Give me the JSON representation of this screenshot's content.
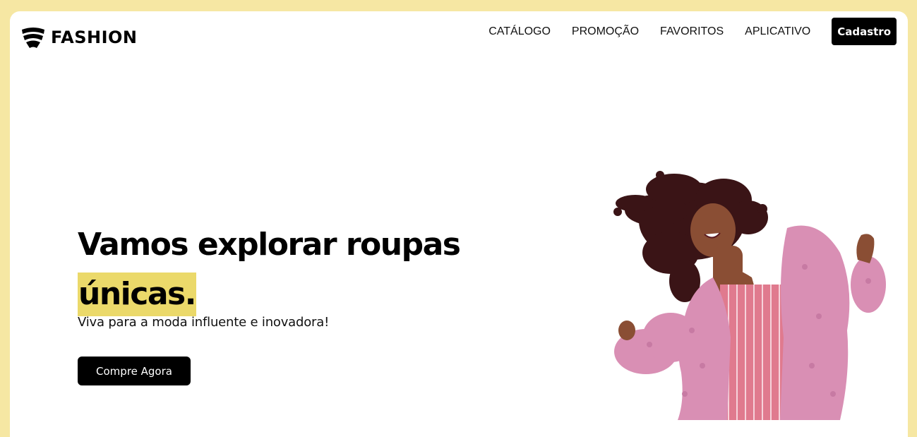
{
  "brand": {
    "name": "FASHION",
    "logo_icon": "wave-stripes-icon"
  },
  "nav": {
    "items": [
      {
        "label": "CATÁLOGO"
      },
      {
        "label": "PROMOÇÃO"
      },
      {
        "label": "FAVORITOS"
      },
      {
        "label": "APLICATIVO"
      }
    ],
    "signup_label": "Cadastro"
  },
  "hero": {
    "title_line1": "Vamos explorar roupas",
    "title_highlight": "únicas.",
    "subtitle": "Viva para a moda influente e inovadora!",
    "cta_label": "Compre Agora",
    "image": "woman-in-pink-fur-coat-dancing"
  },
  "colors": {
    "page_background": "#f6e7a3",
    "card_background": "#ffffff",
    "highlight": "#ebd96a",
    "button_background": "#000000",
    "button_text": "#ffffff",
    "coat_pink": "#d98fb4",
    "dress_pink": "#e07a8e"
  }
}
